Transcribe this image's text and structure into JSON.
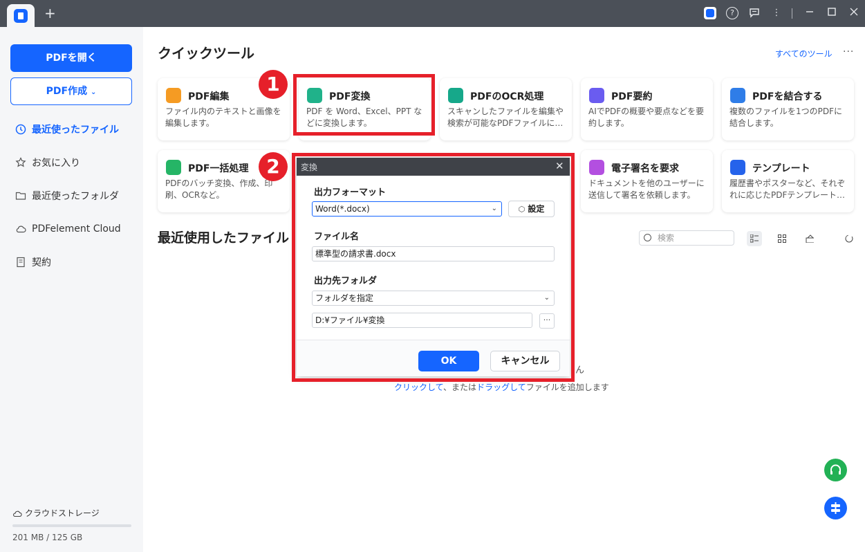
{
  "titlebar": {
    "newtab_icon": "plus-icon",
    "icons": [
      "app-logo-icon",
      "help-icon",
      "feedback-icon",
      "more-vertical-icon",
      "minimize-icon",
      "maximize-icon",
      "close-icon"
    ]
  },
  "sidebar": {
    "open_pdf": "PDFを開く",
    "create_pdf": "PDF作成",
    "items": [
      {
        "label": "最近使ったファイル",
        "icon": "clock-icon",
        "active": true
      },
      {
        "label": "お気に入り",
        "icon": "star-icon",
        "active": false
      },
      {
        "label": "最近使ったフォルダ",
        "icon": "folder-icon",
        "active": false
      },
      {
        "label": "PDFelement Cloud",
        "icon": "cloud-icon",
        "active": false
      },
      {
        "label": "契約",
        "icon": "document-icon",
        "active": false
      }
    ],
    "storage_label": "クラウドストレージ",
    "storage_usage": "201 MB / 125 GB"
  },
  "main": {
    "quick_tools_title": "クイックツール",
    "all_tools": "すべてのツール",
    "cards": [
      {
        "title": "PDF編集",
        "desc": "ファイル内のテキストと画像を編集します。",
        "color": "#f59b23"
      },
      {
        "title": "PDF変換",
        "desc": "PDF を Word、Excel、PPT などに変換します。",
        "color": "#20b28a"
      },
      {
        "title": "PDFのOCR処理",
        "desc": "スキャンしたファイルを編集や検索が可能なPDFファイルに…",
        "color": "#16a88a"
      },
      {
        "title": "PDF要約",
        "desc": "AIでPDFの概要や要点などを要約します。",
        "color": "#6a5cf0"
      },
      {
        "title": "PDFを結合する",
        "desc": "複数のファイルを1つのPDFに結合します。",
        "color": "#2f7de8"
      },
      {
        "title": "PDF一括処理",
        "desc": "PDFのバッチ変換、作成、印刷、OCRなど。",
        "color": "#25b566"
      },
      {
        "title": "電子署名を要求",
        "desc": "ドキュメントを他のユーザーに送信して署名を依頼します。",
        "color": "#b34fe0"
      },
      {
        "title": "テンプレート",
        "desc": "履歴書やポスターなど、それぞれに応じたPDFテンプレート…",
        "color": "#2563eb"
      }
    ],
    "recent_title": "最近使用したファイル",
    "search_placeholder": "検索",
    "empty_tail": "ん",
    "empty_link1": "クリックして",
    "empty_mid": "、または",
    "empty_link2": "ドラッグして",
    "empty_end": "ファイルを追加します"
  },
  "markers": [
    "1",
    "2"
  ],
  "dialog": {
    "title": "変換",
    "format_label": "出力フォーマット",
    "format_value": "Word(*.docx)",
    "settings": "設定",
    "filename_label": "ファイル名",
    "filename_value": "標準型の請求書.docx",
    "folder_label": "出力先フォルダ",
    "folder_option": "フォルダを指定",
    "folder_path": "D:¥ファイル¥変換",
    "browse": "···",
    "ok": "OK",
    "cancel": "キャンセル"
  },
  "colors": {
    "accent": "#1565ff",
    "highlight": "#e6202a",
    "support": "#22b155"
  }
}
